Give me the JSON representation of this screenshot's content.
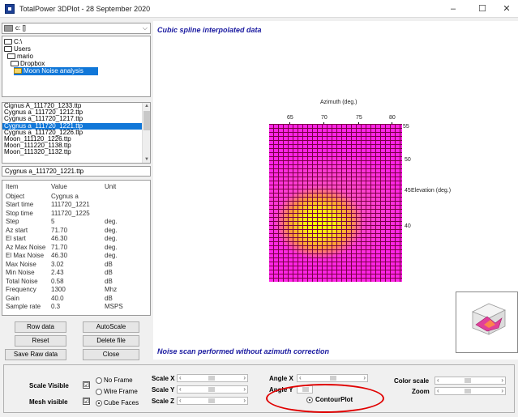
{
  "titlebar": {
    "title": "TotalPower 3DPlot  -  28 September 2020",
    "minimize": "–",
    "maximize": "☐",
    "close": "✕"
  },
  "drive": {
    "label": "c: []"
  },
  "directories": [
    {
      "name": "C:\\",
      "selected": false
    },
    {
      "name": "Users",
      "selected": false
    },
    {
      "name": "mario",
      "selected": false
    },
    {
      "name": "Dropbox",
      "selected": false
    },
    {
      "name": "Moon Noise analysis",
      "selected": true
    }
  ],
  "files": [
    {
      "name": "Cignus A_111720_1233.ttp",
      "selected": false
    },
    {
      "name": "Cygnus a_111720_1212.ttp",
      "selected": false
    },
    {
      "name": "Cygnus a_111720_1217.ttp",
      "selected": false
    },
    {
      "name": "Cygnus a_111720_1221.ttp",
      "selected": true
    },
    {
      "name": "Cygnus a_111720_1226.ttp",
      "selected": false
    },
    {
      "name": "Moon_111120_1226.ttp",
      "selected": false
    },
    {
      "name": "Moon_111220_1138.ttp",
      "selected": false
    },
    {
      "name": "Moon_111320_1132.ttp",
      "selected": false
    }
  ],
  "selected_file": "Cygnus a_111720_1221.ttp",
  "table": {
    "headers": [
      "Item",
      "Value",
      "Unit"
    ],
    "rows": [
      [
        "Object",
        "Cygnus a",
        ""
      ],
      [
        "Start time",
        "111720_1221",
        ""
      ],
      [
        "Stop time",
        "111720_1225",
        ""
      ],
      [
        "Step",
        "5",
        "deg."
      ],
      [
        "Az start",
        "71.70",
        "deg."
      ],
      [
        "El start",
        "46.30",
        "deg."
      ],
      [
        "Az Max Noise",
        "71.70",
        "deg."
      ],
      [
        "El Max Noise",
        "46.30",
        "deg."
      ],
      [
        "Max Noise",
        "3.02",
        "dB"
      ],
      [
        "Min Noise",
        "2.43",
        "dB"
      ],
      [
        "Total Noise",
        "0.58",
        "dB"
      ],
      [
        "Frequency",
        "1300",
        "Mhz"
      ],
      [
        "Gain",
        "40.0",
        "dB"
      ],
      [
        "Sample rate",
        "0.3",
        "MSPS"
      ]
    ]
  },
  "buttons": {
    "row_data": "Row data",
    "autoscale": "AutoScale",
    "reset": "Reset",
    "delete_file": "Delete file",
    "save_raw": "Save Raw data",
    "close": "Close"
  },
  "plot": {
    "title": "Cubic spline interpolated data",
    "note": "Noise scan performed without azimuth correction",
    "x_axis_title": "Azimuth (deg.)",
    "x_ticks": [
      "65",
      "70",
      "75",
      "80"
    ],
    "y_axis_title": "Elevation (deg.)",
    "y_ticks": [
      "55",
      "50",
      "45",
      "40"
    ],
    "colors": {
      "high": "#ffff00",
      "low": "#ff24e6",
      "grid": "#7a0044"
    }
  },
  "controls": {
    "scale_visible": "Scale  Visible",
    "mesh_visible": "Mesh visible",
    "scale_checked": "☑",
    "mesh_checked": "☑",
    "frame_options": [
      "No Frame",
      "Wire Frame",
      "Cube Faces"
    ],
    "frame_selected": 2,
    "scale_x": "Scale X",
    "scale_y": "Scale Y",
    "scale_z": "Scale Z",
    "angle_x": "Angle X",
    "angle_y": "Angle Y",
    "contour": "ContourPlot",
    "color_scale": "Color scale",
    "zoom": "Zoom"
  }
}
